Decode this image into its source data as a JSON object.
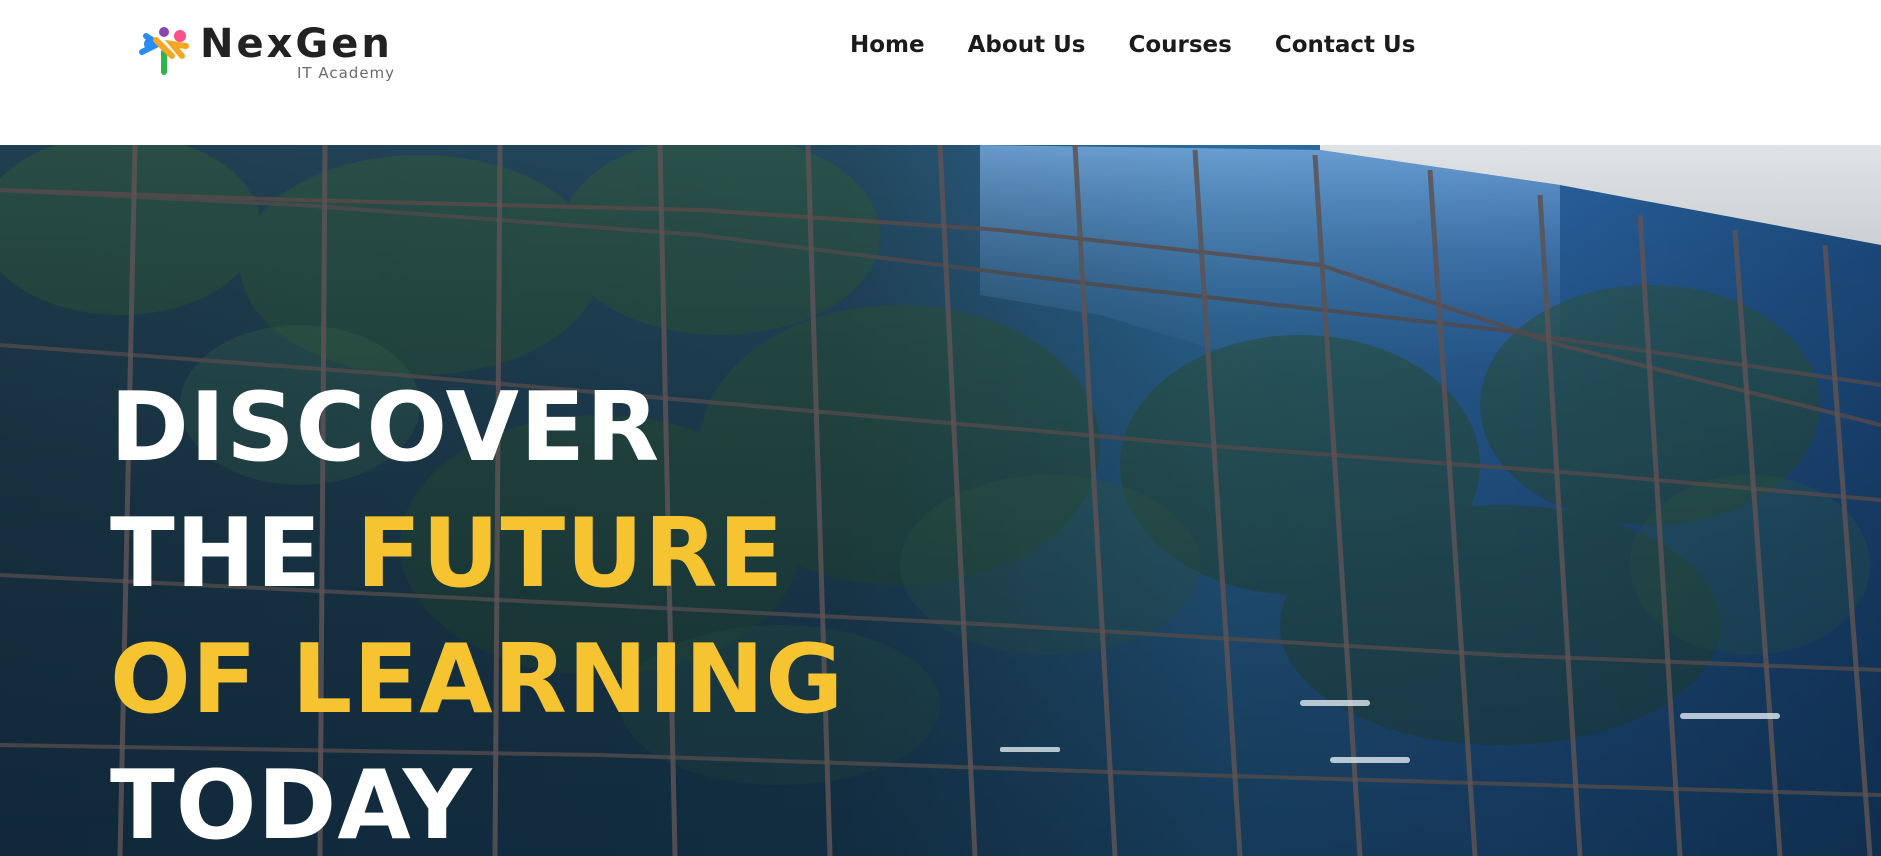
{
  "brand": {
    "name": "NexGen",
    "tagline": "IT Academy",
    "mark_colors": [
      "#ff4f8a",
      "#f5a623",
      "#2fb34a",
      "#2a8bf2",
      "#8e44ad"
    ]
  },
  "nav": {
    "items": [
      {
        "label": "Home"
      },
      {
        "label": "About Us"
      },
      {
        "label": "Courses"
      },
      {
        "label": "Contact Us"
      }
    ]
  },
  "hero": {
    "line1": "DISCOVER",
    "line2_a": "THE ",
    "line2_b": "FUTURE",
    "line3": "OF LEARNING",
    "line4": "TODAY",
    "colors": {
      "text": "#ffffff",
      "highlight": "#f5c430"
    }
  }
}
